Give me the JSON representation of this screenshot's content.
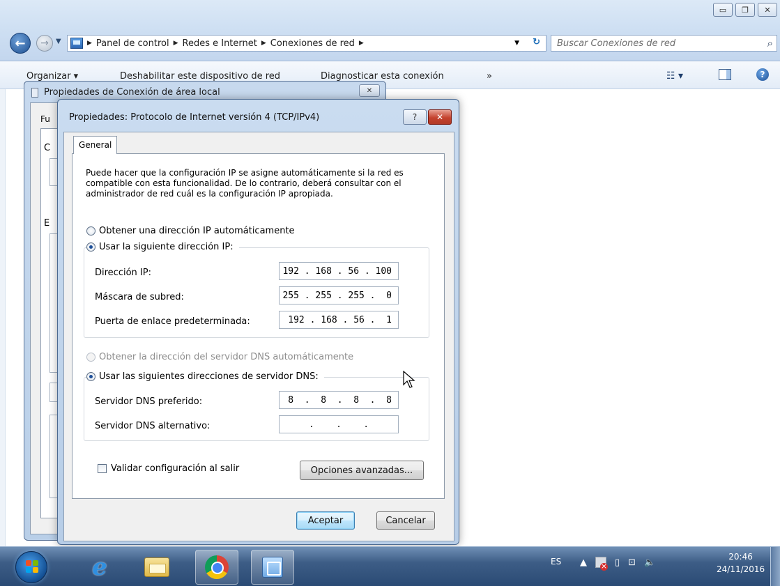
{
  "explorer": {
    "breadcrumbs": [
      "Panel de control",
      "Redes e Internet",
      "Conexiones de red"
    ],
    "search_placeholder": "Buscar Conexiones de red",
    "commands": {
      "organize": "Organizar ▾",
      "disable": "Deshabilitar este dispositivo de red",
      "diagnose": "Diagnosticar esta conexión",
      "more": "»"
    }
  },
  "bg_dialog": {
    "title": "Propiedades de Conexión de área local",
    "tab_fragment": "Fu",
    "fragment_c": "C",
    "fragment_e": "E"
  },
  "dialog": {
    "title": "Propiedades: Protocolo de Internet versión 4 (TCP/IPv4)",
    "help_btn": "?",
    "close_btn": "✕",
    "tab": "General",
    "intro": "Puede hacer que la configuración IP se asigne automáticamente si la red es compatible con esta funcionalidad. De lo contrario, deberá consultar con el administrador de red cuál es la configuración IP apropiada.",
    "radio_ip_auto": "Obtener una dirección IP automáticamente",
    "radio_ip_manual": "Usar la siguiente dirección IP:",
    "ip_label": "Dirección IP:",
    "ip_value": "192 . 168 . 56 . 100",
    "mask_label": "Máscara de subred:",
    "mask_value": "255 . 255 . 255 .  0",
    "gateway_label": "Puerta de enlace predeterminada:",
    "gateway_value": "192 . 168 . 56 .  1",
    "radio_dns_auto": "Obtener la dirección del servidor DNS automáticamente",
    "radio_dns_manual": "Usar las siguientes direcciones de servidor DNS:",
    "dns_pref_label": "Servidor DNS preferido:",
    "dns_pref_value": " 8  .  8  .  8  .  8",
    "dns_alt_label": "Servidor DNS alternativo:",
    "dns_alt_value": ".    .    .",
    "validate_label": "Validar configuración al salir",
    "advanced_btn": "Opciones avanzadas...",
    "ok_btn": "Aceptar",
    "cancel_btn": "Cancelar",
    "selected_ip_mode": "manual",
    "selected_dns_mode": "manual",
    "validate_checked": false
  },
  "taskbar": {
    "apps": [
      "internet-explorer",
      "file-explorer",
      "google-chrome",
      "network-connections"
    ],
    "lang": "ES",
    "time": "20:46",
    "date": "24/11/2016"
  }
}
